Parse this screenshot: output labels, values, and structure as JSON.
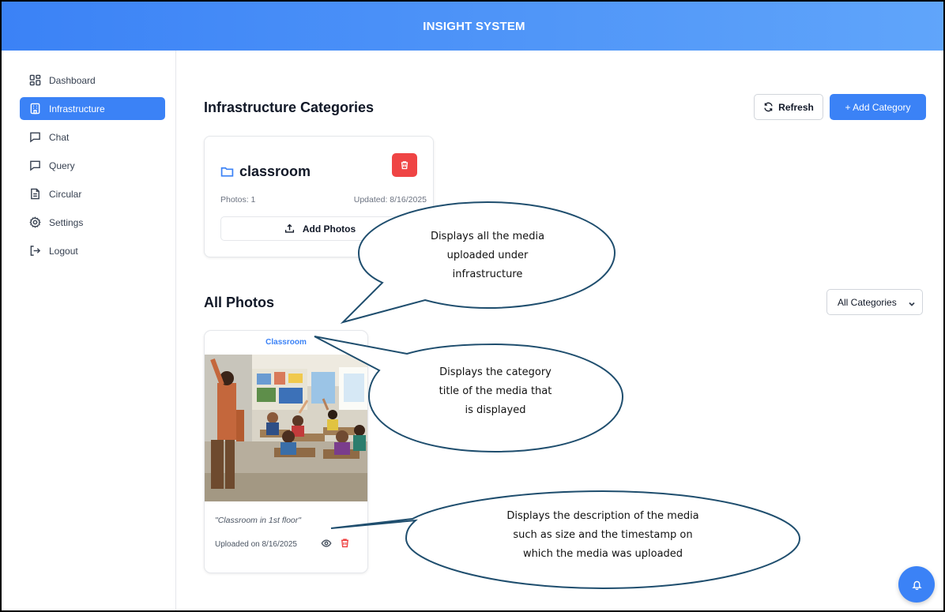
{
  "header": {
    "title": "INSIGHT SYSTEM"
  },
  "sidebar": {
    "items": [
      {
        "label": "Dashboard",
        "icon": "dashboard-grid-icon"
      },
      {
        "label": "Infrastructure",
        "icon": "building-icon",
        "active": true
      },
      {
        "label": "Chat",
        "icon": "chat-bubble-icon"
      },
      {
        "label": "Query",
        "icon": "chat-bubble-icon"
      },
      {
        "label": "Circular",
        "icon": "document-icon"
      },
      {
        "label": "Settings",
        "icon": "gear-icon"
      },
      {
        "label": "Logout",
        "icon": "logout-icon"
      }
    ]
  },
  "main": {
    "categories_title": "Infrastructure Categories",
    "refresh_label": "Refresh",
    "add_category_label": "+ Add Category",
    "category_card": {
      "name": "classroom",
      "photos": "Photos: 1",
      "updated": "Updated: 8/16/2025",
      "add_photos_label": "Add Photos"
    },
    "all_photos_title": "All Photos",
    "filter": {
      "selected": "All Categories"
    },
    "photo_card": {
      "category": "Classroom",
      "description": "\"Classroom in 1st floor\"",
      "uploaded": "Uploaded on 8/16/2025"
    }
  },
  "annotations": {
    "callout1": [
      "Displays all the media",
      "uploaded under",
      "infrastructure"
    ],
    "callout2": [
      "Displays the category",
      "title of the media that",
      "is displayed"
    ],
    "callout3": [
      "Displays the description of the media",
      "such as size and the timestamp on",
      "which the media was uploaded"
    ]
  },
  "colors": {
    "accent": "#3b82f6",
    "danger": "#ef4444",
    "callout_stroke": "#1f4e6e"
  }
}
